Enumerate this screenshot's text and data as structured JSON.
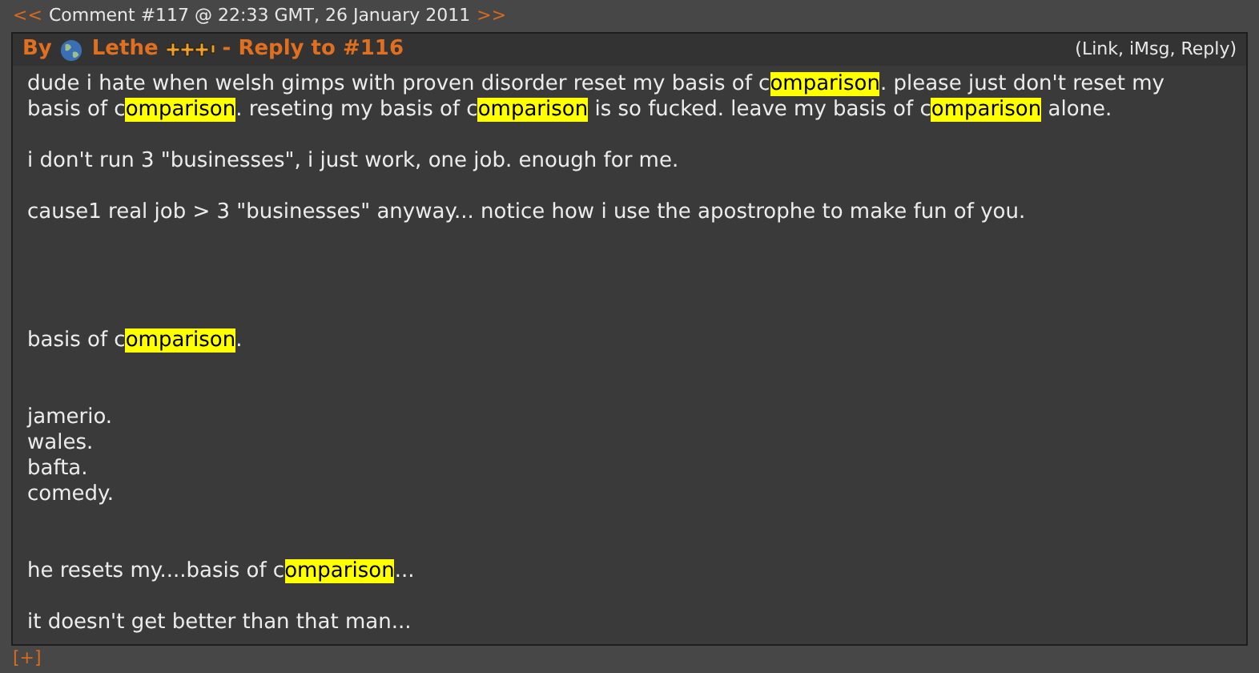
{
  "nav": {
    "prev": "<<",
    "title": "Comment #117 @ 22:33 GMT, 26 January 2011",
    "next": ">>"
  },
  "comment": {
    "by": "By",
    "author": "Lethe",
    "reply_to": "- Reply to #116",
    "actions": "(Link, iMsg, Reply)",
    "paragraphs": [
      [
        {
          "text": "dude i hate when welsh gimps with proven disorder reset my basis of c",
          "highlighted": false
        },
        {
          "text": "omparison",
          "highlighted": true
        },
        {
          "text": ". please just don't reset my basis of c",
          "highlighted": false
        },
        {
          "text": "omparison",
          "highlighted": true
        },
        {
          "text": ". reseting my basis of c",
          "highlighted": false
        },
        {
          "text": "omparison",
          "highlighted": true
        },
        {
          "text": " is so fucked. leave my basis of c",
          "highlighted": false
        },
        {
          "text": "omparison",
          "highlighted": true
        },
        {
          "text": " alone.",
          "highlighted": false
        }
      ],
      [
        {
          "text": "i don't run 3 \"businesses\", i just work, one job. enough for me.",
          "highlighted": false
        }
      ],
      [
        {
          "text": "cause1 real job > 3 \"businesses\" anyway... notice how i use the apostrophe to make fun of you.",
          "highlighted": false
        }
      ],
      [
        {
          "text": "basis of c",
          "highlighted": false
        },
        {
          "text": "omparison",
          "highlighted": true
        },
        {
          "text": ".",
          "highlighted": false
        }
      ],
      [
        {
          "text": "jamerio.",
          "highlighted": false
        }
      ],
      [
        {
          "text": "wales.",
          "highlighted": false
        }
      ],
      [
        {
          "text": "bafta.",
          "highlighted": false
        }
      ],
      [
        {
          "text": "comedy.",
          "highlighted": false
        }
      ],
      [
        {
          "text": "he resets my....basis of c",
          "highlighted": false
        },
        {
          "text": "omparison",
          "highlighted": true
        },
        {
          "text": "...",
          "highlighted": false
        }
      ],
      [
        {
          "text": "it doesn't get better than that man...",
          "highlighted": false
        }
      ]
    ]
  },
  "expand": "[+]"
}
